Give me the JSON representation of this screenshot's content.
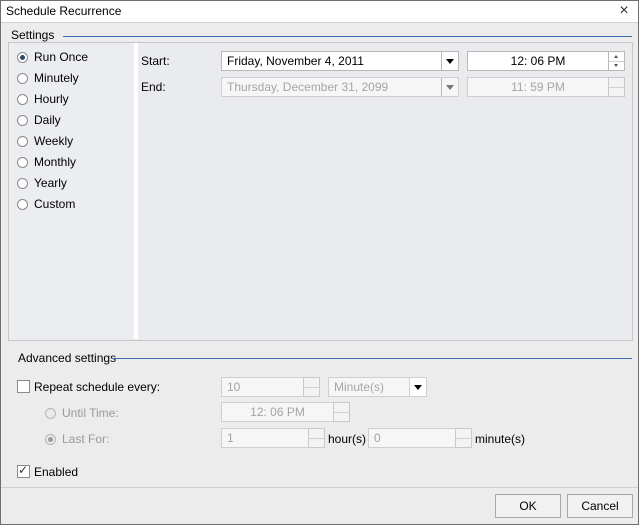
{
  "window": {
    "title": "Schedule Recurrence"
  },
  "settings": {
    "header": "Settings",
    "options": [
      {
        "label": "Run Once",
        "checked": true
      },
      {
        "label": "Minutely",
        "checked": false
      },
      {
        "label": "Hourly",
        "checked": false
      },
      {
        "label": "Daily",
        "checked": false
      },
      {
        "label": "Weekly",
        "checked": false
      },
      {
        "label": "Monthly",
        "checked": false
      },
      {
        "label": "Yearly",
        "checked": false
      },
      {
        "label": "Custom",
        "checked": false
      }
    ],
    "start_label": "Start:",
    "start_date": "Friday, November 4, 2011",
    "start_time": "12: 06 PM",
    "end_label": "End:",
    "end_date": "Thursday, December 31, 2099",
    "end_time": "11: 59 PM"
  },
  "advanced": {
    "header": "Advanced settings",
    "repeat_label": "Repeat schedule every:",
    "repeat_value": "10",
    "repeat_unit": "Minute(s)",
    "until_time_label": "Until Time:",
    "until_time_value": "12: 06 PM",
    "last_for_label": "Last For:",
    "last_for_hours": "1",
    "hours_label": "hour(s)",
    "last_for_minutes": "0",
    "minutes_label": "minute(s)",
    "enabled_label": "Enabled"
  },
  "buttons": {
    "ok": "OK",
    "cancel": "Cancel"
  },
  "colors": {
    "accent_line": "#3b6bb0",
    "panel_bg": "#e9ebee"
  }
}
